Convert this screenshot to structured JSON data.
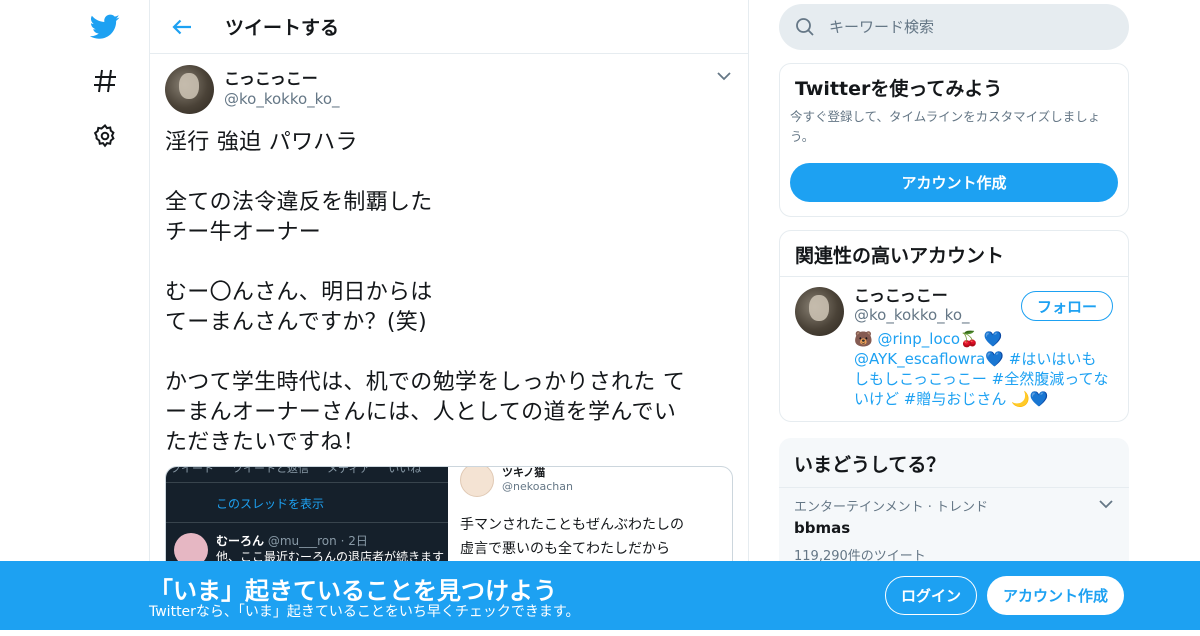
{
  "colors": {
    "accent": "#1da1f2",
    "text": "#14171a",
    "muted": "#657786",
    "border": "#e6ecf0"
  },
  "nav": {
    "items": [
      {
        "icon": "twitter-bird-icon"
      },
      {
        "icon": "hashtag-icon"
      },
      {
        "icon": "gear-icon"
      }
    ]
  },
  "header": {
    "title": "ツイートする"
  },
  "tweet": {
    "author_name": "こっこっこー",
    "author_handle": "@ko_kokko_ko_",
    "text": "淫行 強迫 パワハラ\n\n全ての法令違反を制覇した\nチー牛オーナー\n\nむー〇んさん、明日からは\nてーまんさんですか？(笑)\n\nかつて学生時代は、机での勉学をしっかりされた て\nーまんオーナーさんには、人としての道を学んでい\nただきたいですね！",
    "quote": {
      "image": {
        "tabs": [
          "ツイート",
          "ツイートと返信",
          "メディア",
          "いいね"
        ],
        "thread_link": "このスレッドを表示",
        "reply_name": "むーろん",
        "reply_meta": "@mu___ron · 2日",
        "reply_text": "他、ここ最近むーろんの退店者が続きます"
      },
      "name": "ツキノ猫",
      "handle": "@nekoachan",
      "text": "手マンされたこともぜんぶわたしの\n虚言で悪いのも全てわたしだから"
    }
  },
  "search": {
    "placeholder": "キーワード検索"
  },
  "signup_card": {
    "title": "Twitterを使ってみよう",
    "desc": "今すぐ登録して、タイムラインをカスタマイズしましょう。",
    "button": "アカウント作成"
  },
  "related": {
    "title": "関連性の高いアカウント",
    "name": "こっこっこー",
    "handle": "@ko_kokko_ko_",
    "bio": "🐻 @rinp_loco🍒 💙 @AYK_escaflowra💙 #はいはいもしもしこっこっこー #全然腹減ってないけど #贈与おじさん 🌙💙",
    "follow": "フォロー"
  },
  "trends": {
    "title": "いまどうしてる？",
    "items": [
      {
        "category": "エンターテインメント · トレンド",
        "name": "bbmas",
        "count": "119,290件のツイート"
      }
    ]
  },
  "banner": {
    "title": "「いま」起きていることを見つけよう",
    "subtitle": "Twitterなら、「いま」起きていることをいち早くチェックできます。",
    "login": "ログイン",
    "signup": "アカウント作成"
  }
}
